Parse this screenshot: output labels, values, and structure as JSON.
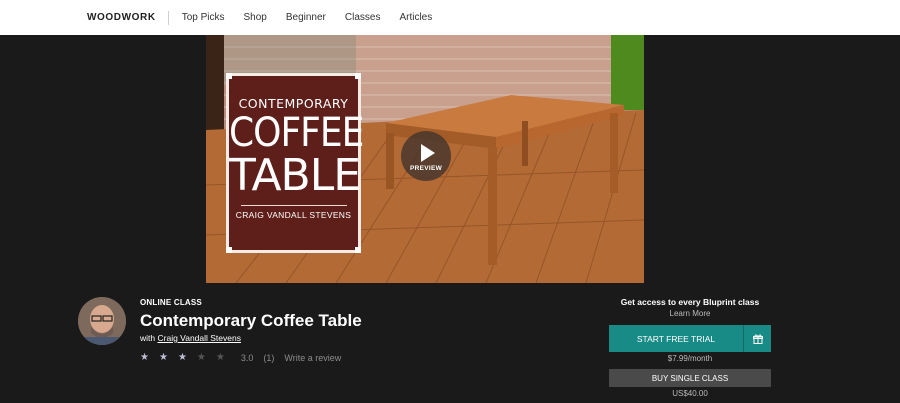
{
  "nav": {
    "brand": "WOODWORK",
    "items": [
      "Top Picks",
      "Shop",
      "Beginner",
      "Classes",
      "Articles"
    ]
  },
  "hero": {
    "card_line1": "CONTEMPORARY",
    "card_line2": "COFFEE",
    "card_line3": "TABLE",
    "card_author": "CRAIG VANDALL STEVENS",
    "preview_label": "PREVIEW",
    "play_icon": "play-icon"
  },
  "course": {
    "label": "ONLINE CLASS",
    "title": "Contemporary Coffee Table",
    "by_prefix": "with",
    "instructor": "Craig Vandall Stevens",
    "rating": 3.0,
    "rating_text": "3.0",
    "review_count": "(1)",
    "write_review": "Write a review",
    "stars_filled": 3,
    "stars_total": 5
  },
  "cta": {
    "access_text": "Get access to every Bluprint class",
    "learn_more": "Learn More",
    "trial_label": "START FREE TRIAL",
    "gift_icon": "gift-icon",
    "trial_price": "$7.99/month",
    "single_label": "BUY SINGLE CLASS",
    "single_price": "US$40.00"
  },
  "colors": {
    "accent": "#188b86",
    "background": "#1a1a1a",
    "card": "#5e1f1b"
  }
}
